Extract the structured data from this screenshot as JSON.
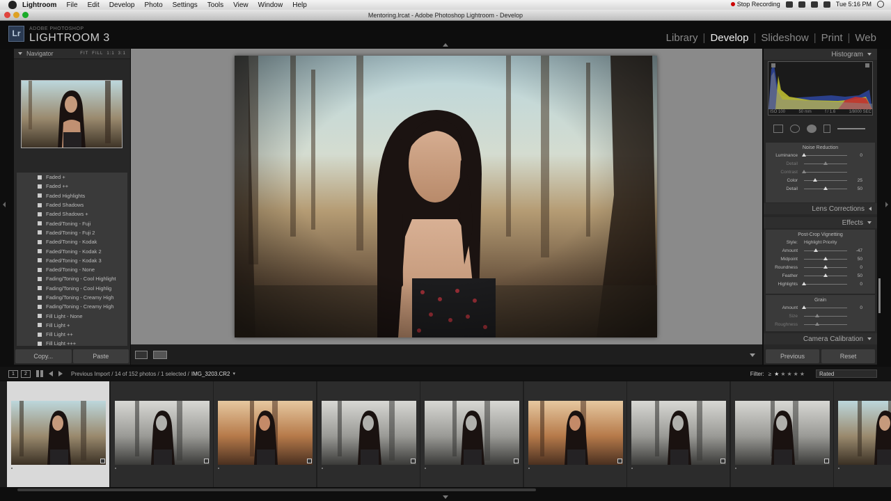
{
  "menubar": {
    "items": [
      "Lightroom",
      "File",
      "Edit",
      "Develop",
      "Photo",
      "Settings",
      "Tools",
      "View",
      "Window",
      "Help"
    ],
    "stop_recording": "Stop Recording",
    "clock": "Tue 5:16 PM"
  },
  "window": {
    "title": "Mentoring.lrcat - Adobe Photoshop Lightroom - Develop"
  },
  "brand": {
    "small": "ADOBE PHOTOSHOP",
    "big": "LIGHTROOM 3",
    "logo": "Lr"
  },
  "modules": {
    "items": [
      "Library",
      "Develop",
      "Slideshow",
      "Print",
      "Web"
    ],
    "active": "Develop"
  },
  "navigator": {
    "title": "Navigator",
    "options": [
      "FIT",
      "FILL",
      "1:1",
      "3:1"
    ]
  },
  "presets": [
    "Faded +",
    "Faded ++",
    "Faded Highlights",
    "Faded Shadows",
    "Faded Shadows +",
    "Faded/Toning - Fuji",
    "Faded/Toning - Fuji 2",
    "Faded/Toning - Kodak",
    "Faded/Toning - Kodak 2",
    "Faded/Toning - Kodak 3",
    "Faded/Toning - None",
    "Fading/Toning - Cool Highlight",
    "Fading/Toning - Cool Highlig",
    "Fading/Toning - Creamy High",
    "Fading/Toning - Creamy High",
    "Fill Light - None",
    "Fill Light +",
    "Fill Light ++",
    "Fill Light +++"
  ],
  "left_buttons": {
    "copy": "Copy...",
    "paste": "Paste"
  },
  "histogram": {
    "title": "Histogram",
    "iso": "ISO 100",
    "focal": "50 mm",
    "aperture": "f / 1.6",
    "shutter": "1/8000 SEC"
  },
  "noise_reduction": {
    "title": "Noise Reduction",
    "rows": [
      {
        "label": "Luminance",
        "value": "0",
        "pos": 0
      },
      {
        "label": "Detail",
        "value": "",
        "pos": 0.5
      },
      {
        "label": "Contrast",
        "value": "",
        "pos": 0
      },
      {
        "label": "Color",
        "value": "25",
        "pos": 0.25
      },
      {
        "label": "Detail",
        "value": "50",
        "pos": 0.5
      }
    ]
  },
  "lens_corrections": {
    "title": "Lens Corrections"
  },
  "effects": {
    "title": "Effects",
    "vignette_title": "Post-Crop Vignetting",
    "style_label": "Style:",
    "style_value": "Highlight Priority",
    "rows": [
      {
        "label": "Amount",
        "value": "-47",
        "pos": 0.27
      },
      {
        "label": "Midpoint",
        "value": "50",
        "pos": 0.5
      },
      {
        "label": "Roundness",
        "value": "0",
        "pos": 0.5
      },
      {
        "label": "Feather",
        "value": "50",
        "pos": 0.5
      },
      {
        "label": "Highlights",
        "value": "0",
        "pos": 0
      }
    ],
    "grain_title": "Grain",
    "grain_rows": [
      {
        "label": "Amount",
        "value": "0",
        "pos": 0
      },
      {
        "label": "Size",
        "value": "",
        "pos": 0.3
      },
      {
        "label": "Roughness",
        "value": "",
        "pos": 0.3
      }
    ]
  },
  "camera_calibration": {
    "title": "Camera Calibration"
  },
  "right_buttons": {
    "previous": "Previous",
    "reset": "Reset"
  },
  "filmstrip_bar": {
    "screen1": "1",
    "screen2": "2",
    "source": "Previous Import / 14 of 152 photos / 1 selected /",
    "filename": "IMG_3203.CR2",
    "filter_label": "Filter:",
    "filter_op": "≥",
    "stars": "★★★★★",
    "stars_on": 1,
    "filter_value": "Rated"
  },
  "filmstrip": [
    {
      "tone": "color",
      "selected": true
    },
    {
      "tone": "bw"
    },
    {
      "tone": "warm"
    },
    {
      "tone": "bw"
    },
    {
      "tone": "bw"
    },
    {
      "tone": "warm"
    },
    {
      "tone": "bw"
    },
    {
      "tone": "bw"
    },
    {
      "tone": "color"
    }
  ]
}
